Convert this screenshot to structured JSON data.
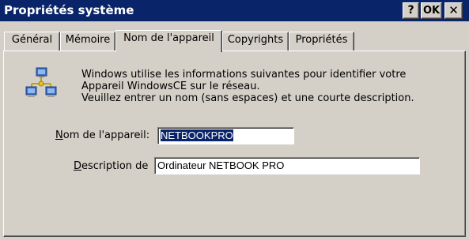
{
  "window": {
    "title": "Propriétés système",
    "help_label": "?",
    "ok_label": "OK",
    "close_label": "✕"
  },
  "tabs": [
    {
      "label": "Général",
      "active": false
    },
    {
      "label": "Mémoire",
      "active": false
    },
    {
      "label": "Nom de l'appareil",
      "active": true
    },
    {
      "label": "Copyrights",
      "active": false
    },
    {
      "label": "Propriétés",
      "active": false
    }
  ],
  "info": {
    "icon": "network-computers-icon",
    "line1": "Windows utilise les informations suivantes pour identifier votre",
    "line2": "Appareil WindowsCE sur le réseau.",
    "line3": "Veuillez entrer un nom (sans espaces) et une courte description."
  },
  "form": {
    "name_label_key": "N",
    "name_label_rest": "om de l'appareil:",
    "name_value": "NETBOOKPRO",
    "desc_label_key": "D",
    "desc_label_rest": "escription de",
    "desc_value": "Ordinateur NETBOOK PRO"
  },
  "colors": {
    "titlebar": "#0a246a",
    "face": "#d4d0c8",
    "selection": "#0a246a"
  }
}
